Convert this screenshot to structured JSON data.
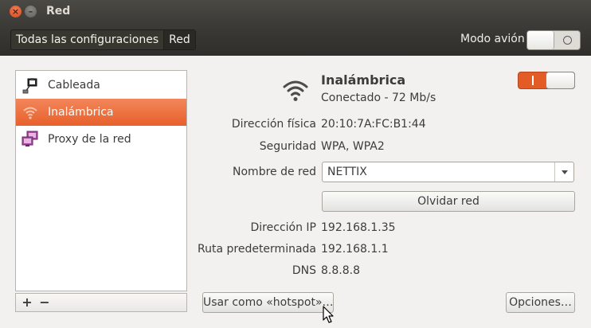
{
  "window": {
    "title": "Red"
  },
  "toolbar": {
    "breadcrumbs": [
      "Todas las configuraciones",
      "Red"
    ],
    "airplane_label": "Modo avión",
    "airplane_mode_on": false
  },
  "sidebar": {
    "items": [
      {
        "label": "Cableada",
        "icon": "wired-network-icon",
        "selected": false
      },
      {
        "label": "Inalámbrica",
        "icon": "wifi-icon",
        "selected": true
      },
      {
        "label": "Proxy de la red",
        "icon": "proxy-icon",
        "selected": false
      }
    ],
    "add_label": "+",
    "remove_label": "−"
  },
  "connection": {
    "title": "Inalámbrica",
    "status": "Conectado - 72 Mb/s",
    "enabled": true,
    "details": [
      {
        "label": "Dirección física",
        "value": "20:10:7A:FC:B1:44"
      },
      {
        "label": "Seguridad",
        "value": "WPA, WPA2"
      }
    ],
    "network_name_label": "Nombre de red",
    "network_name_value": "NETTIX",
    "forget_button": "Olvidar red",
    "ip_details": [
      {
        "label": "Dirección IP",
        "value": "192.168.1.35"
      },
      {
        "label": "Ruta predeterminada",
        "value": "192.168.1.1"
      },
      {
        "label": "DNS",
        "value": "8.8.8.8"
      }
    ]
  },
  "footer": {
    "hotspot_button": "Usar como «hotspot»…",
    "options_button": "Opciones…"
  },
  "colors": {
    "accent": "#e8602b",
    "titlebar": "#3c3b37",
    "window_bg": "#f2f1f0"
  }
}
